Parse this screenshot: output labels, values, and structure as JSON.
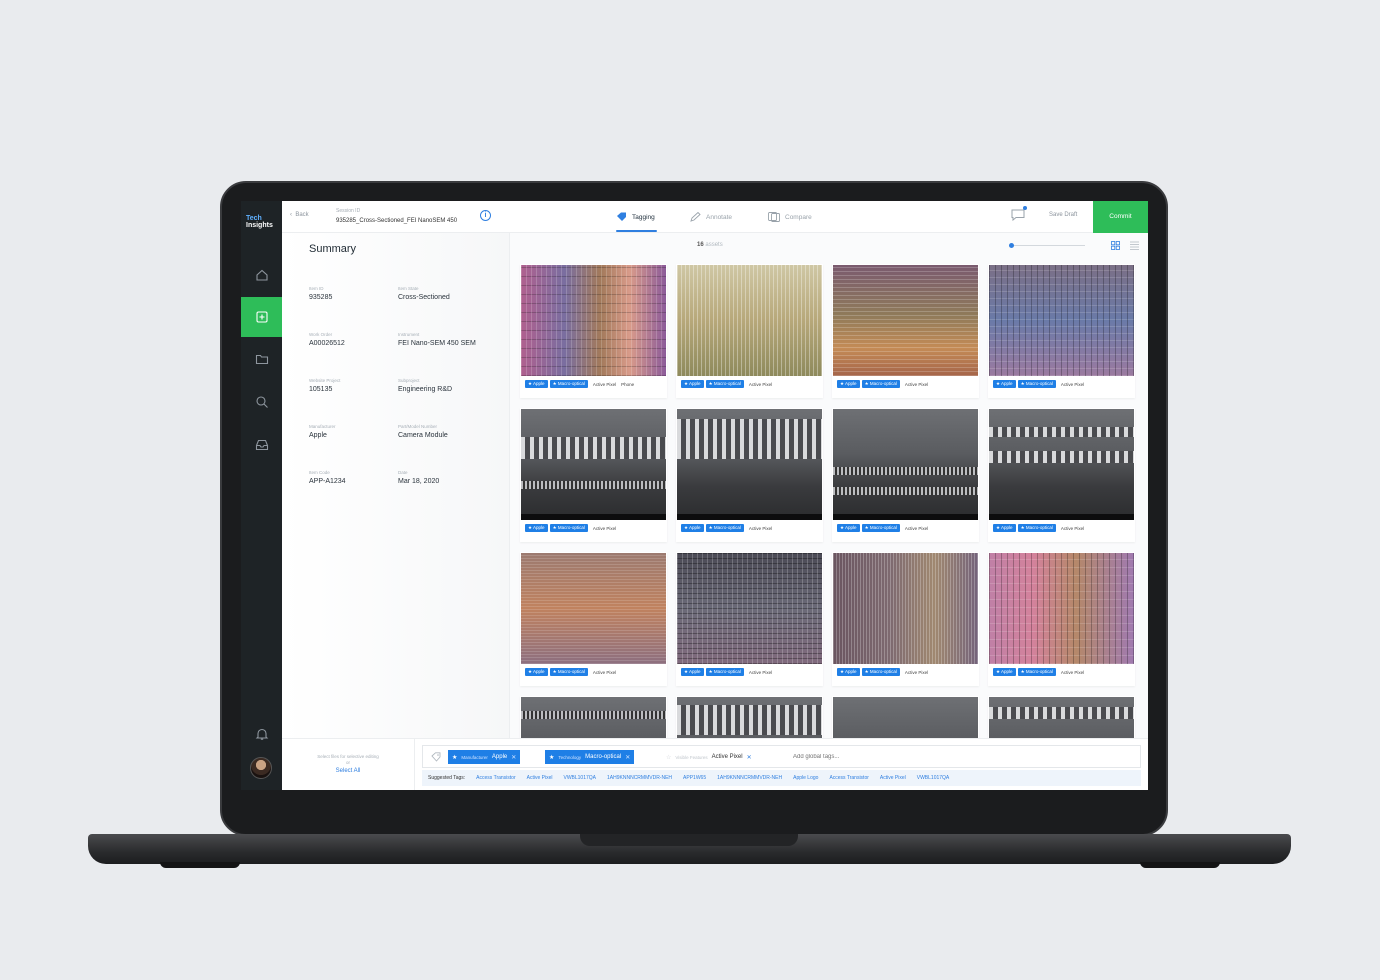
{
  "brand": {
    "logo_line1": "Tech",
    "logo_line2": "Insights"
  },
  "topbar": {
    "back_label": "Back",
    "session_label": "Session ID",
    "session_value": "935285_Cross-Sectioned_FEI NanoSEM 450",
    "tabs": [
      {
        "label": "Tagging",
        "active": true
      },
      {
        "label": "Annotate",
        "active": false
      },
      {
        "label": "Compare",
        "active": false
      }
    ],
    "save_draft_label": "Save Draft",
    "commit_label": "Commit"
  },
  "summary": {
    "title": "Summary",
    "fields": [
      {
        "label": "Item ID",
        "value": "935285"
      },
      {
        "label": "Item State",
        "value": "Cross-Sectioned"
      },
      {
        "label": "Work Order",
        "value": "A00026512"
      },
      {
        "label": "Instrument",
        "value": "FEI Nano-SEM 450 SEM"
      },
      {
        "label": "Website Project",
        "value": "105135"
      },
      {
        "label": "Subproject",
        "value": "Engineering R&D"
      },
      {
        "label": "Manufacturer",
        "value": "Apple"
      },
      {
        "label": "Part/Model Number",
        "value": "Camera Module"
      },
      {
        "label": "Item Code",
        "value": "APP-A1234"
      },
      {
        "label": "Date",
        "value": "Mar 18, 2020"
      }
    ]
  },
  "selection": {
    "hint_line1": "Select files for selective editing",
    "hint_line2": "or",
    "select_all_label": "Select All"
  },
  "grid": {
    "assets_count": "16",
    "assets_label": "assets",
    "cards": [
      {
        "tags": [
          "Apple",
          "Macro-optical"
        ],
        "extra": [
          "Active Pixel",
          "Phone"
        ]
      },
      {
        "tags": [
          "Apple",
          "Macro-optical"
        ],
        "extra": [
          "Active Pixel"
        ]
      },
      {
        "tags": [
          "Apple",
          "Macro-optical"
        ],
        "extra": [
          "Active Pixel"
        ]
      },
      {
        "tags": [
          "Apple",
          "Macro-optical"
        ],
        "extra": [
          "Active Pixel"
        ]
      },
      {
        "tags": [
          "Apple",
          "Macro-optical"
        ],
        "extra": [
          "Active Pixel"
        ]
      },
      {
        "tags": [
          "Apple",
          "Macro-optical"
        ],
        "extra": [
          "Active Pixel"
        ]
      },
      {
        "tags": [
          "Apple",
          "Macro-optical"
        ],
        "extra": [
          "Active Pixel"
        ]
      },
      {
        "tags": [
          "Apple",
          "Macro-optical"
        ],
        "extra": [
          "Active Pixel"
        ]
      },
      {
        "tags": [
          "Apple",
          "Macro-optical"
        ],
        "extra": [
          "Active Pixel"
        ]
      },
      {
        "tags": [
          "Apple",
          "Macro-optical"
        ],
        "extra": [
          "Active Pixel"
        ]
      },
      {
        "tags": [
          "Apple",
          "Macro-optical"
        ],
        "extra": [
          "Active Pixel"
        ]
      },
      {
        "tags": [
          "Apple",
          "Macro-optical"
        ],
        "extra": [
          "Active Pixel"
        ]
      }
    ]
  },
  "tagbar": {
    "global_tags": [
      {
        "key": "Manufacturer",
        "value": "Apple"
      },
      {
        "key": "Technology",
        "value": "Macro-optical"
      }
    ],
    "ghost_tag": {
      "key": "Visible Features",
      "value": "Active Pixel"
    },
    "add_placeholder": "Add global tags...",
    "suggested_label": "Suggested Tags:",
    "suggested": [
      "Access Transistor",
      "Active Pixel",
      "VWBL1017QA",
      "1AH9KNNNCRMMVDR-NEH",
      "APP1W65",
      "1AH9KNNNCRMMVDR-NEH",
      "Apple Logo",
      "Access Transistor",
      "Active Pixel",
      "VWBL1017QA"
    ]
  },
  "colors": {
    "accent": "#2f7fe0",
    "commit": "#2ebd59",
    "rail": "#1e2326"
  },
  "icons": [
    "home-icon",
    "add-icon",
    "folder-icon",
    "search-icon",
    "inbox-icon",
    "bell-icon",
    "tag-icon",
    "chat-icon",
    "info-icon",
    "grid-view-icon",
    "list-view-icon"
  ]
}
